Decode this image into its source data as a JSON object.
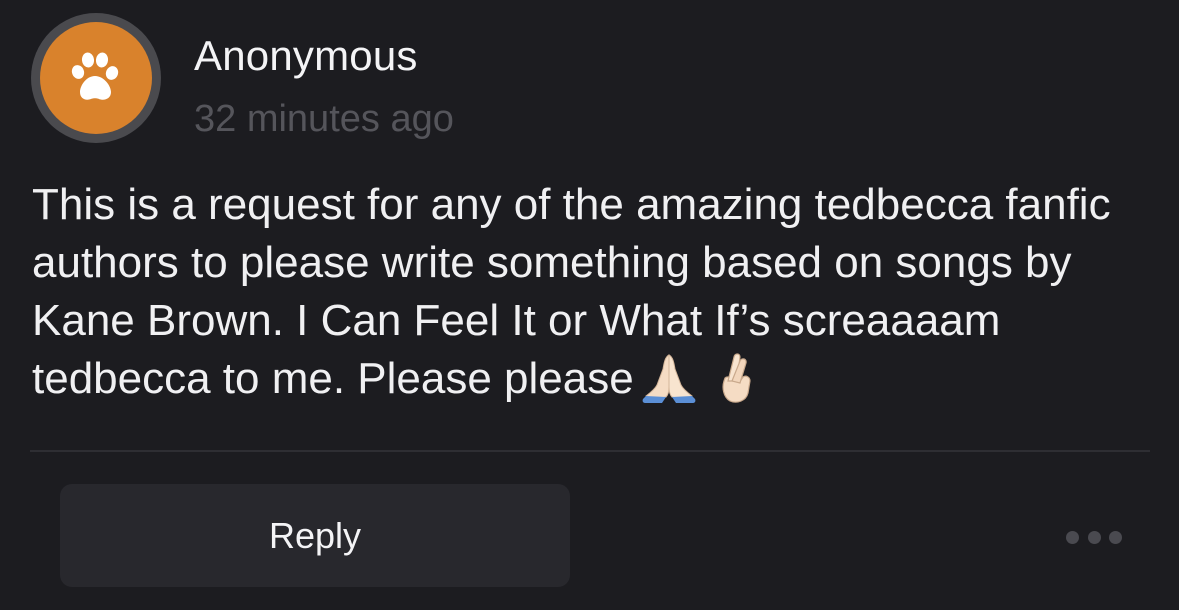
{
  "post": {
    "author": "Anonymous",
    "timestamp": "32 minutes ago",
    "avatar_icon": "paw-icon",
    "avatar_color": "#d9822c",
    "avatar_ring_color": "#4a4a4e",
    "text": "This is a request for any of the amazing tedbecca fanfic authors to please write something based on songs by Kane Brown. I Can Feel It or What If’s screaaaam tedbecca to me. Please please",
    "emojis": [
      "folded-hands-icon",
      "crossed-fingers-icon"
    ]
  },
  "actions": {
    "reply_label": "Reply",
    "more_icon": "more-dots-icon"
  },
  "colors": {
    "background": "#1c1c20",
    "button_bg": "#28282d",
    "timestamp": "#55555b"
  }
}
